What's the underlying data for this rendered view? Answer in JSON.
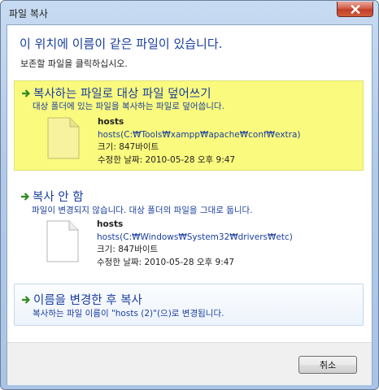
{
  "window": {
    "title": "파일 복사"
  },
  "dialog": {
    "headline": "이 위치에 이름이 같은 파일이 있습니다.",
    "instruction": "보존할 파일을 클릭하십시오."
  },
  "options": [
    {
      "title": "복사하는 파일로 대상 파일 덮어쓰기",
      "description": "대상 폴더에 있는 파일을 복사하는 파일로 덮어씁니다.",
      "file": {
        "name": "hosts",
        "path": "hosts(C:₩Tools₩xampp₩apache₩conf₩extra)",
        "size": "크기: 847바이트",
        "modified": "수정한 날짜: 2010-05-28 오후 9:47"
      }
    },
    {
      "title": "복사 안 함",
      "description": "파일이 변경되지 않습니다. 대상 폴더의 파일을 그대로 둡니다.",
      "file": {
        "name": "hosts",
        "path": "hosts(C:₩Windows₩System32₩drivers₩etc)",
        "size": "크기: 847바이트",
        "modified": "수정한 날짜: 2010-05-28 오후 9:47"
      }
    },
    {
      "title": "이름을 변경한 후 복사",
      "description": "복사하는 파일 이름이 \"hosts (2)\"(으)로 변경됩니다."
    }
  ],
  "footer": {
    "cancel_label": "취소"
  },
  "colors": {
    "accent": "#1a3e9e",
    "highlight": "#fafa7e",
    "arrow": "#2e8b1f"
  },
  "icons": {
    "arrow": "green-arrow-icon",
    "file": "file-icon",
    "close": "close-icon"
  }
}
